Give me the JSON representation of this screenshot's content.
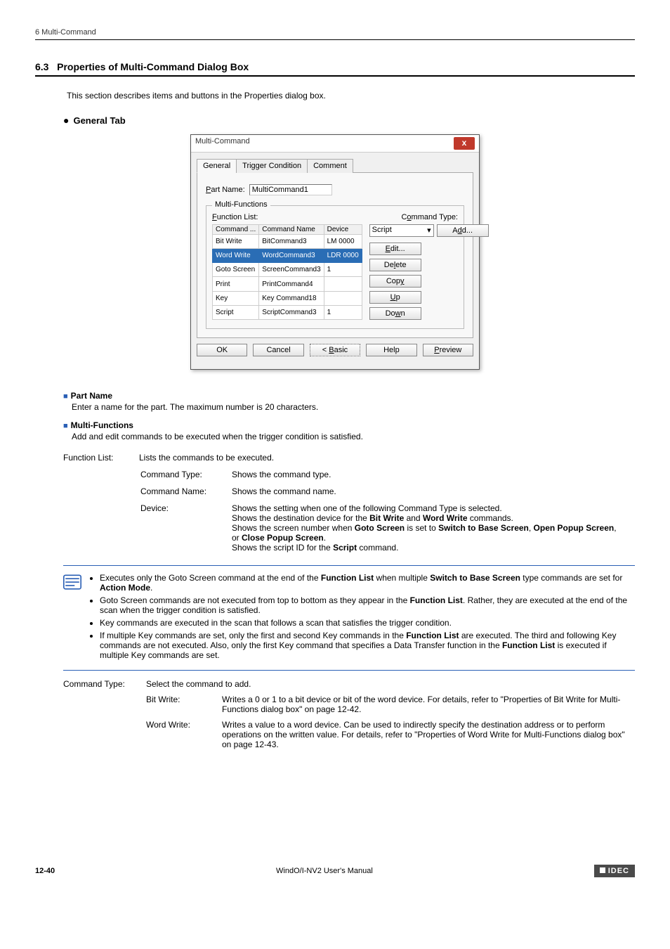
{
  "header": {
    "title": "6 Multi-Command"
  },
  "section": {
    "number": "6.3",
    "title": "Properties of Multi-Command Dialog Box",
    "intro": "This section describes items and buttons in the Properties dialog box.",
    "tabLabel": "General",
    "tabSuffix": " Tab"
  },
  "dialog": {
    "title": "Multi-Command",
    "close": "x",
    "tabs": {
      "general": "General",
      "trigger": "Trigger Condition",
      "comment": "Comment"
    },
    "partNameLabel": "Part Name:",
    "partNameValue": "MultiCommand1",
    "groupLegend": "Multi-Functions",
    "functionListLabel": "Function List:",
    "commandTypeLabel": "Command Type:",
    "commandTypeValue": "Script",
    "addBtn": "Add...",
    "editBtn": "Edit...",
    "deleteBtn": "Delete",
    "copyBtn": "Copy",
    "upBtn": "Up",
    "downBtn": "Down",
    "headers": {
      "command": "Command ...",
      "name": "Command Name",
      "device": "Device"
    },
    "rows": [
      {
        "cmd": "Bit Write",
        "name": "BitCommand3",
        "device": "LM 0000"
      },
      {
        "cmd": "Word Write",
        "name": "WordCommand3",
        "device": "LDR 0000"
      },
      {
        "cmd": "Goto Screen",
        "name": "ScreenCommand3",
        "device": "1"
      },
      {
        "cmd": "Print",
        "name": "PrintCommand4",
        "device": ""
      },
      {
        "cmd": "Key",
        "name": "Key Command18",
        "device": ""
      },
      {
        "cmd": "Script",
        "name": "ScriptCommand3",
        "device": "1"
      }
    ],
    "footer": {
      "ok": "OK",
      "cancel": "Cancel",
      "basic": "< Basic",
      "help": "Help",
      "preview": "Preview"
    }
  },
  "partName": {
    "heading": "Part Name",
    "body": "Enter a name for the part. The maximum number is 20 characters."
  },
  "multiFunc": {
    "heading": "Multi-Functions",
    "body": "Add and edit commands to be executed when the trigger condition is satisfied."
  },
  "funcList": {
    "label": "Function List:",
    "desc": "Lists the commands to be executed.",
    "rows": {
      "ctLabel": "Command Type:",
      "ctDesc": "Shows the command type.",
      "cnLabel": "Command Name:",
      "cnDesc": "Shows the command name.",
      "devLabel": "Device:",
      "dev1": "Shows the setting when one of the following Command Type is selected.",
      "dev2a": "Shows the destination device for the ",
      "dev2b": "Bit Write",
      "dev2c": " and ",
      "dev2d": "Word Write",
      "dev2e": " commands.",
      "dev3a": "Shows the screen number when ",
      "dev3b": "Goto Screen",
      "dev3c": " is set to ",
      "dev3d": "Switch to Base Screen",
      "dev3e": ", ",
      "dev3f": "Open Popup Screen",
      "dev3g": ", or ",
      "dev3h": "Close Popup Screen",
      "dev3i": ".",
      "dev4a": "Shows the script ID for the ",
      "dev4b": "Script",
      "dev4c": " command."
    }
  },
  "note": {
    "li1a": "Executes only the Goto Screen command at the end of the ",
    "li1b": "Function List",
    "li1c": " when multiple ",
    "li1d": "Switch to Base Screen",
    "li1e": " type commands are set for ",
    "li1f": "Action Mode",
    "li1g": ".",
    "li2a": "Goto Screen commands are not executed from top to bottom as they appear in the ",
    "li2b": "Function List",
    "li2c": ". Rather, they are executed at the end of the scan when the trigger condition is satisfied.",
    "li3": "Key commands are executed in the scan that follows a scan that satisfies the trigger condition.",
    "li4a": "If multiple Key commands are set, only the first and second Key commands in the ",
    "li4b": "Function List",
    "li4c": " are executed. The third and following Key commands are not executed. Also, only the first Key command that specifies a Data Transfer function in the ",
    "li4d": "Function List",
    "li4e": " is executed if multiple Key commands are set."
  },
  "cmdType": {
    "label": "Command Type:",
    "desc": "Select the command to add.",
    "bw": {
      "label": "Bit Write:",
      "desc": "Writes a 0 or 1 to a bit device or bit of the word device. For details, refer to \"Properties of Bit Write for Multi-Functions dialog box\" on page 12-42."
    },
    "ww": {
      "label": "Word Write:",
      "desc": "Writes a value to a word device. Can be used to indirectly specify the destination address or to perform operations on the written value. For details, refer to \"Properties of Word Write for Multi-Functions dialog box\" on page 12-43."
    }
  },
  "footer": {
    "page": "12-40",
    "manual": "WindO/I-NV2 User's Manual",
    "brand": "IDEC"
  }
}
